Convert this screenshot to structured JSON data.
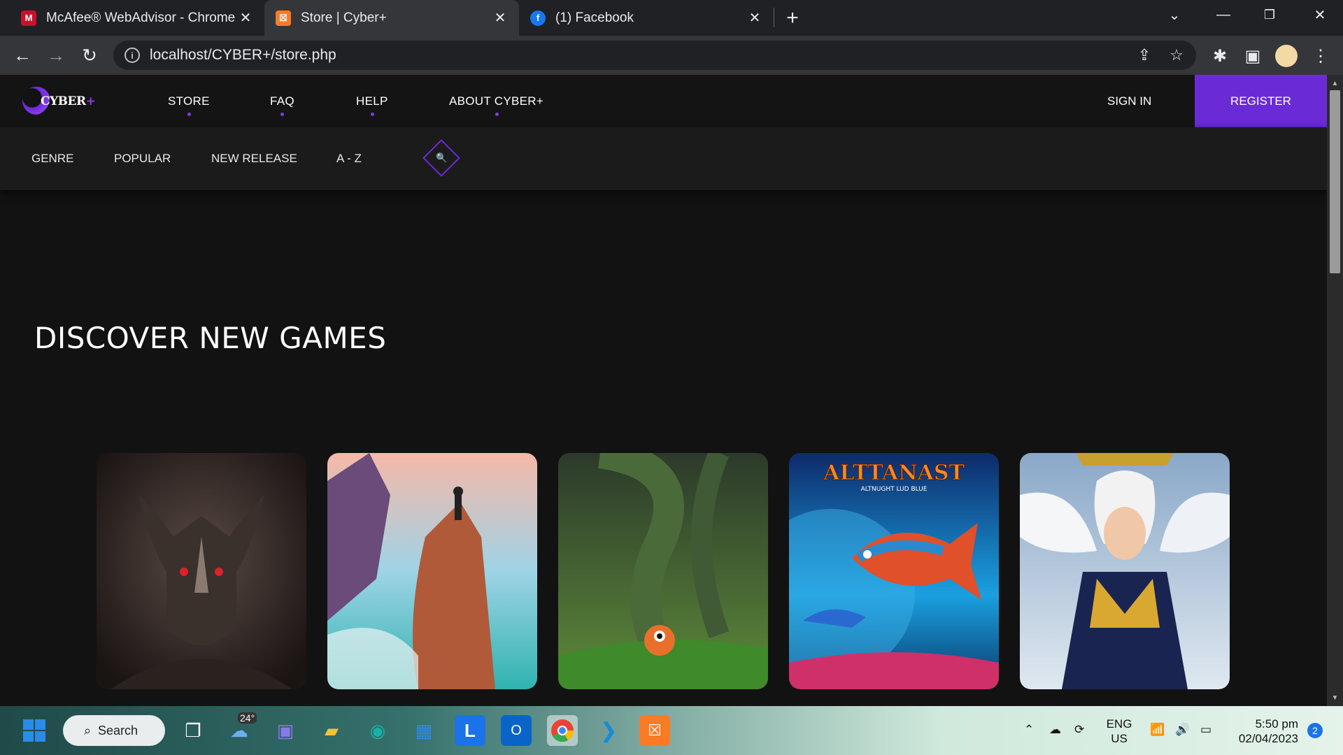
{
  "browser": {
    "tabs": [
      {
        "title": "McAfee® WebAdvisor - Chrome",
        "favicon": "mcafee-icon"
      },
      {
        "title": "Store | Cyber+",
        "favicon": "xampp-icon"
      },
      {
        "title": "(1) Facebook",
        "favicon": "facebook-icon"
      }
    ],
    "url": "localhost/CYBER+/store.php"
  },
  "site": {
    "logo_text": "CYBER",
    "logo_plus": "+",
    "nav": {
      "store": "STORE",
      "faq": "FAQ",
      "help": "HELP",
      "about": "ABOUT CYBER+",
      "sign_in": "SIGN IN",
      "register": "REGISTER"
    },
    "subnav": {
      "genre": "GENRE",
      "popular": "POPULAR",
      "new_release": "NEW RELEASE",
      "a_z": "A - Z"
    },
    "heading": "DISCOVER NEW GAMES",
    "cards": [
      {
        "art": "dark-mask-warrior"
      },
      {
        "art": "cliff-ocean-traveler"
      },
      {
        "art": "jungle-tentacle-creature"
      },
      {
        "art": "altlantast-fish",
        "title_art": "ALTTANAST",
        "subtitle_art": "ALTNUGHT LUD BLUE"
      },
      {
        "art": "winged-golden-knight"
      }
    ],
    "colors": {
      "accent": "#6a2bd6",
      "background": "#121212"
    }
  },
  "taskbar": {
    "search_label": "Search",
    "weather": "24°",
    "language": "ENG",
    "region": "US",
    "time": "5:50 pm",
    "date": "02/04/2023",
    "notifications": "2"
  }
}
